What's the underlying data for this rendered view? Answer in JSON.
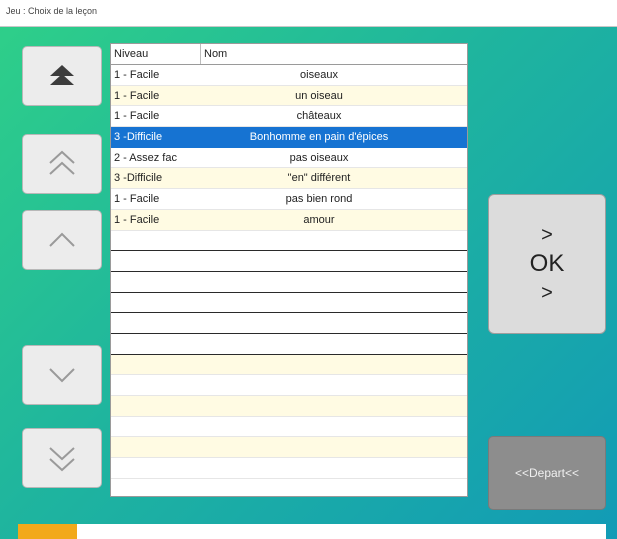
{
  "window": {
    "title": "Jeu : Choix de la leçon"
  },
  "nav": {
    "first_icon": "double-up-solid-arrow-icon",
    "page_up_icon": "double-chevron-up-icon",
    "up_icon": "chevron-up-icon",
    "down_icon": "chevron-down-icon",
    "page_down_icon": "double-chevron-down-icon"
  },
  "table": {
    "columns": [
      "Niveau",
      "Nom"
    ],
    "rows": [
      {
        "niveau": "1 - Facile",
        "nom": "oiseaux"
      },
      {
        "niveau": "1 - Facile",
        "nom": "un oiseau"
      },
      {
        "niveau": "1 - Facile",
        "nom": "châteaux"
      },
      {
        "niveau": "3 -Difficile",
        "nom": "Bonhomme en pain d'épices"
      },
      {
        "niveau": "2 - Assez fac",
        "nom": "pas oiseaux"
      },
      {
        "niveau": "3 -Difficile",
        "nom": "\"en\" différent"
      },
      {
        "niveau": "1 - Facile",
        "nom": "pas bien rond"
      },
      {
        "niveau": "1 - Facile",
        "nom": "amour"
      }
    ],
    "selected_index": 3
  },
  "ok_button": {
    "top_arrow": ">",
    "label": "OK",
    "bottom_arrow": ">"
  },
  "depart_button": {
    "label": "<<Depart<<"
  },
  "progress": {
    "fraction": 0.1
  },
  "colors": {
    "selection": "#1673d2",
    "alt_row": "#fffbe3",
    "progress": "#f2a91a"
  }
}
